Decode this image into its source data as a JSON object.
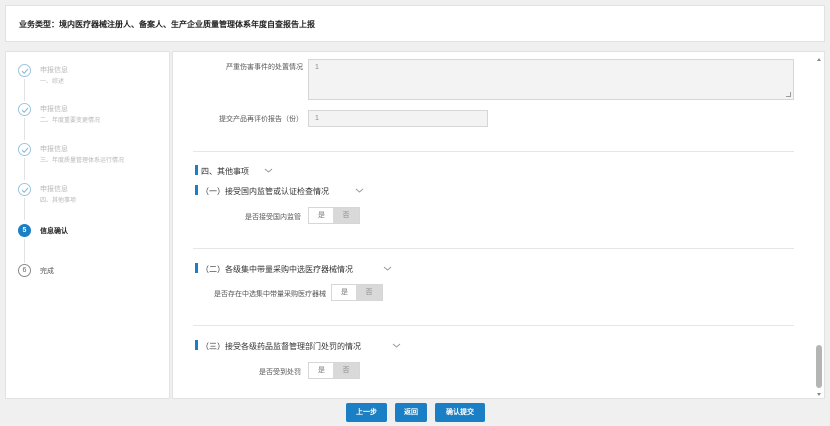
{
  "header": {
    "title": "业务类型：境内医疗器械注册人、备案人、生产企业质量管理体系年度自查报告上报"
  },
  "steps": [
    {
      "number": "",
      "title": "申报信息",
      "subtitle": "一、综述",
      "state": "done"
    },
    {
      "number": "",
      "title": "申报信息",
      "subtitle": "二、年度重要变更情况",
      "state": "done"
    },
    {
      "number": "",
      "title": "申报信息",
      "subtitle": "三、年度质量管理体系运行情况",
      "state": "done"
    },
    {
      "number": "",
      "title": "申报信息",
      "subtitle": "四、其他事项",
      "state": "done"
    },
    {
      "number": "5",
      "title": "信息确认",
      "subtitle": "",
      "state": "active"
    },
    {
      "number": "6",
      "title": "完成",
      "subtitle": "",
      "state": "todo"
    }
  ],
  "form": {
    "severe_event_label": "严重伤害事件的处置情况",
    "severe_event_value": "1",
    "reevaluation_label": "提交产品再评价报告（份）",
    "reevaluation_value": "1",
    "section4_title": "四、其他事项",
    "sub1_title": "（一）接受国内监管或认证检查情况",
    "sub1_question": "是否接受国内监管",
    "sub2_title": "（二）各级集中带量采购中选医疗器械情况",
    "sub2_question": "是否存在中选集中带量采购医疗器械",
    "sub3_title": "（三）接受各级药品监督管理部门处罚的情况",
    "sub3_question": "是否受到处罚",
    "yes_label": "是",
    "no_label": "否"
  },
  "footer": {
    "prev_label": "上一步",
    "back_label": "返回",
    "submit_label": "确认提交"
  },
  "colors": {
    "accent": "#1a7fc4",
    "toggle_selected_bg": "#d9d9d9"
  }
}
